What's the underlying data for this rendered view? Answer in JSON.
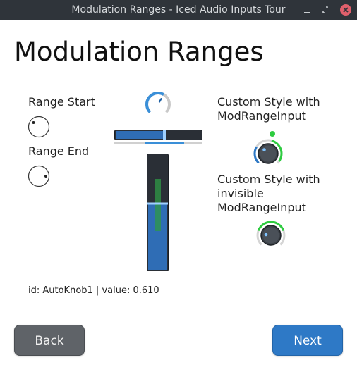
{
  "window": {
    "title": "Modulation Ranges - Iced Audio Inputs Tour"
  },
  "page": {
    "title": "Modulation Ranges"
  },
  "labels": {
    "range_start": "Range Start",
    "range_end": "Range End",
    "custom_style_line1": "Custom Style with",
    "custom_style_line2": "ModRangeInput",
    "custom_invisible_line1": "Custom Style with",
    "custom_invisible_line2": "invisible",
    "custom_invisible_line3": "ModRangeInput"
  },
  "status": {
    "text": "id: AutoKnob1  |  value: 0.610"
  },
  "buttons": {
    "back": "Back",
    "next": "Next"
  },
  "controls": {
    "auto_knob_value": 0.61,
    "h_slider_value": 0.57,
    "v_slider_value": 0.58
  },
  "colors": {
    "accent_blue": "#2e79c6",
    "mod_green": "#2ecc40",
    "titlebar": "#2f343a"
  },
  "icons": {
    "minimize": "minimize-icon",
    "restore": "restore-icon",
    "close": "close-icon"
  }
}
